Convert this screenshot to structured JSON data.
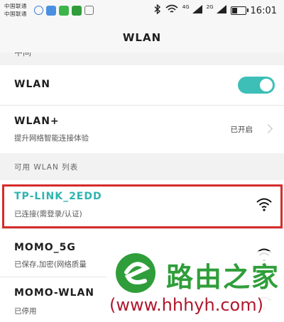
{
  "status_bar": {
    "carrier_1": "中国联通",
    "carrier_2": "中国联通",
    "net_1": "4G",
    "net_2": "2G",
    "time": "16:01",
    "battery_level": 0.35
  },
  "header": {
    "title": "WLAN"
  },
  "partial_item": "中间",
  "wlan_toggle": {
    "label": "WLAN",
    "on": true
  },
  "wlan_plus": {
    "label": "WLAN+",
    "description": "提升网络智能连接体验",
    "status": "已开启"
  },
  "available_section": {
    "label": "可用 WLAN 列表"
  },
  "networks": [
    {
      "ssid": "TP-LINK_2EDD",
      "status": "已连接(需登录/认证)",
      "connected": true
    },
    {
      "ssid": "MOMO_5G",
      "status": "已保存,加密(网络质量",
      "connected": false
    },
    {
      "ssid": "MOMO-WLAN",
      "status": "已停用",
      "connected": false
    }
  ],
  "watermark": {
    "brand": "路由之家",
    "url": "(www.hhhyh.com)"
  },
  "colors": {
    "accent": "#3dbfb8",
    "highlight": "#d62b2b",
    "watermark_green": "#2f9e3a",
    "watermark_red": "#b0182d"
  }
}
